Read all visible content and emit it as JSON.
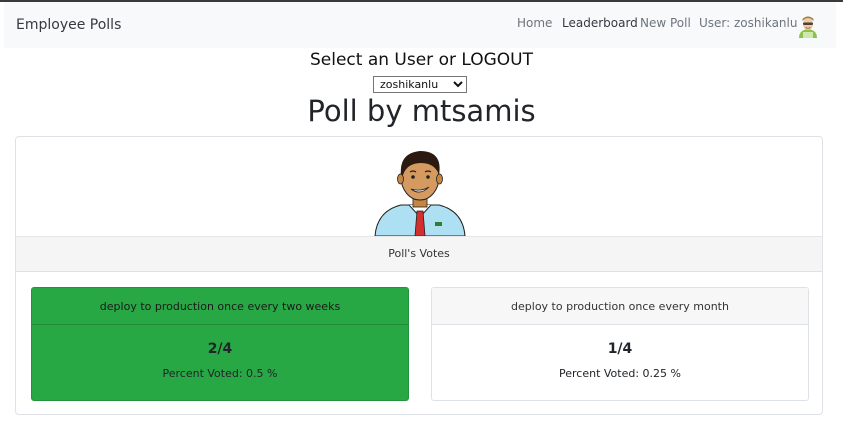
{
  "nav": {
    "brand": "Employee Polls",
    "home": "Home",
    "leaderboard": "Leaderboard",
    "new_poll": "New Poll",
    "user_label": "User: zoshikanlu"
  },
  "user_switch": {
    "heading": "Select an User or LOGOUT",
    "selected": "zoshikanlu"
  },
  "poll": {
    "title": "Poll by mtsamis",
    "votes_header": "Poll's Votes",
    "options": [
      {
        "text": "deploy to production once every two weeks",
        "count": "2/4",
        "percent": "Percent Voted: 0.5 %",
        "voted": true
      },
      {
        "text": "deploy to production once every month",
        "count": "1/4",
        "percent": "Percent Voted: 0.25 %",
        "voted": false
      }
    ]
  },
  "colors": {
    "voted_option": "#28a745",
    "navbar_bg": "#f8f9fa",
    "card_border": "#dee2e6"
  },
  "icons": {
    "nav_avatar": "user-avatar-icon",
    "author_avatar": "author-avatar-icon",
    "select_arrow": "chevron-down-icon"
  }
}
